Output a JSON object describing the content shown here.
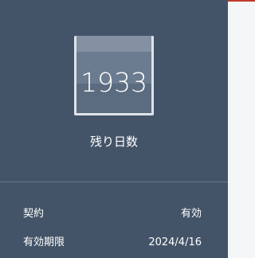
{
  "remaining": {
    "days_value": "1933",
    "days_label": "残り日数"
  },
  "details": [
    {
      "key": "契約",
      "value": "有効"
    },
    {
      "key": "有効期限",
      "value": "2024/4/16"
    }
  ],
  "colors": {
    "panel_bg": "#445468",
    "accent": "#c0392b",
    "calendar_header": "#8491a3"
  }
}
